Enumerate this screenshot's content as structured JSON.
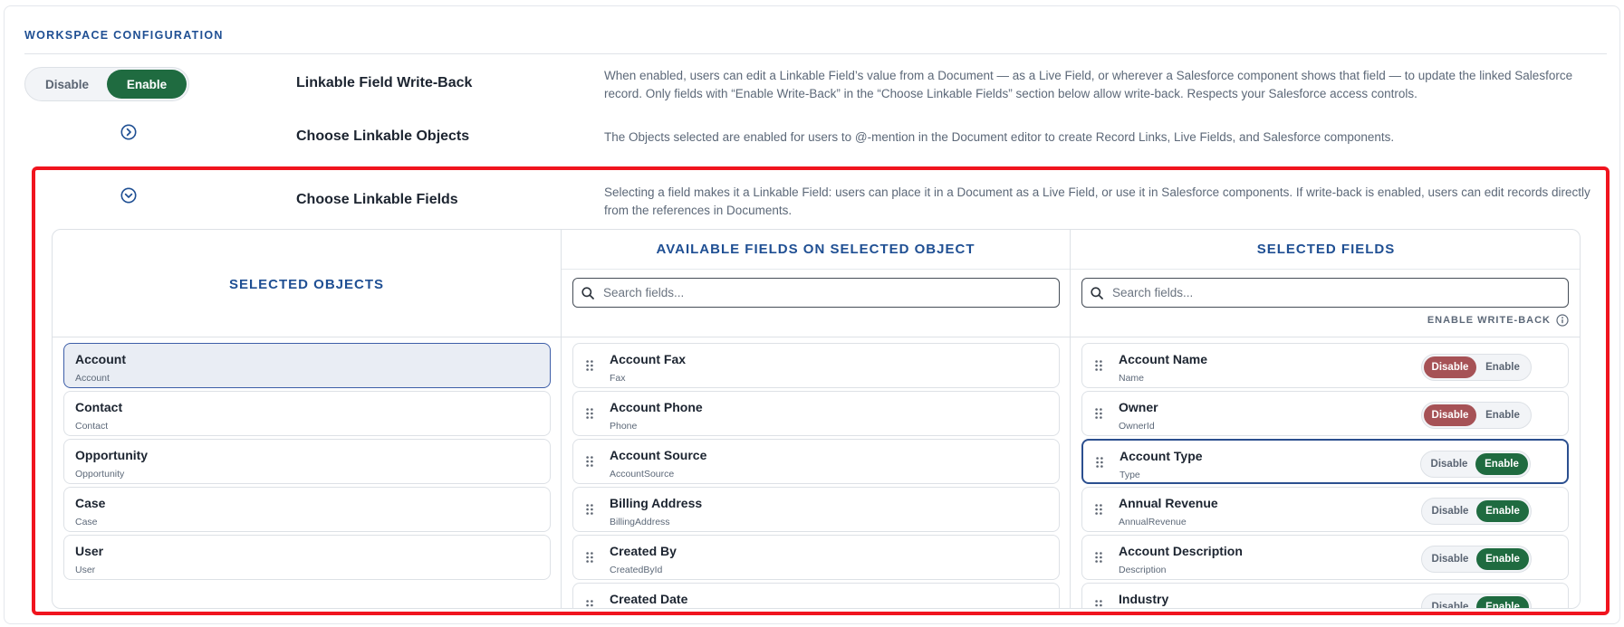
{
  "section": {
    "title": "WORKSPACE CONFIGURATION"
  },
  "write_back": {
    "disable_label": "Disable",
    "enable_label": "Enable",
    "label": "Linkable Field Write-Back",
    "description": "When enabled, users can edit a Linkable Field’s value from a Document — as a Live Field, or wherever a Salesforce component shows that field — to update the linked Salesforce record. Only fields with “Enable Write-Back” in the “Choose Linkable Fields” section below allow write-back. Respects your Salesforce access controls.",
    "state": "enabled"
  },
  "linkable_objects": {
    "label": "Choose Linkable Objects",
    "description": "The Objects selected are enabled for users to @-mention in the Document editor to create Record Links, Live Fields, and Salesforce components.",
    "icon": "chevron-right-circle-icon"
  },
  "linkable_fields": {
    "label": "Choose Linkable Fields",
    "description": "Selecting a field makes it a Linkable Field: users can place it in a Document as a Live Field, or use it in Salesforce components. If write-back is enabled, users can edit records directly from the references in Documents.",
    "icon": "chevron-down-circle-icon"
  },
  "panel": {
    "selected_objects": {
      "heading": "SELECTED OBJECTS",
      "items": [
        {
          "name": "Account",
          "api": "Account",
          "selected": true
        },
        {
          "name": "Contact",
          "api": "Contact"
        },
        {
          "name": "Opportunity",
          "api": "Opportunity"
        },
        {
          "name": "Case",
          "api": "Case"
        },
        {
          "name": "User",
          "api": "User"
        }
      ]
    },
    "available_fields": {
      "heading": "AVAILABLE FIELDS ON SELECTED OBJECT",
      "search_placeholder": "Search fields...",
      "items": [
        {
          "name": "Account Fax",
          "api": "Fax"
        },
        {
          "name": "Account Phone",
          "api": "Phone"
        },
        {
          "name": "Account Source",
          "api": "AccountSource"
        },
        {
          "name": "Billing Address",
          "api": "BillingAddress"
        },
        {
          "name": "Created By",
          "api": "CreatedById"
        },
        {
          "name": "Created Date",
          "api": ""
        }
      ]
    },
    "selected_fields": {
      "heading": "SELECTED FIELDS",
      "search_placeholder": "Search fields...",
      "enable_write_back_label": "ENABLE WRITE-BACK",
      "disable_label": "Disable",
      "enable_label": "Enable",
      "items": [
        {
          "name": "Account Name",
          "api": "Name",
          "write_back": "disabled"
        },
        {
          "name": "Owner",
          "api": "OwnerId",
          "write_back": "disabled"
        },
        {
          "name": "Account Type",
          "api": "Type",
          "write_back": "enabled",
          "focused": true
        },
        {
          "name": "Annual Revenue",
          "api": "AnnualRevenue",
          "write_back": "enabled"
        },
        {
          "name": "Account Description",
          "api": "Description",
          "write_back": "enabled"
        },
        {
          "name": "Industry",
          "api": "",
          "write_back": "enabled"
        }
      ]
    }
  },
  "colors": {
    "accent_blue": "#1f4f93",
    "enable_green": "#1f6b40",
    "disable_red": "#a65256",
    "highlight_red": "#f0141e"
  }
}
